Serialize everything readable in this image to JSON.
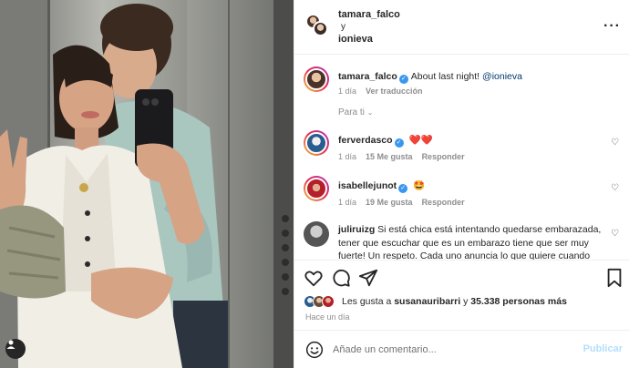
{
  "header": {
    "user1": "tamara_falco",
    "separator": "y",
    "user2": "ionieva",
    "more_icon": "more-horizontal-icon"
  },
  "caption": {
    "username": "tamara_falco",
    "text": "About last night!",
    "mention": "@ionieva",
    "time": "1 día",
    "translate": "Ver traducción"
  },
  "filter": {
    "label": "Para ti"
  },
  "comments": [
    {
      "username": "ferverdasco",
      "text": "❤️❤️",
      "time": "1 día",
      "likes": "15 Me gusta",
      "reply": "Responder"
    },
    {
      "username": "isabellejunot",
      "text": "🤩",
      "time": "1 día",
      "likes": "19 Me gusta",
      "reply": "Responder"
    },
    {
      "username": "juliruizg",
      "text": "Si está chica está intentando quedarse embarazada, tener que escuchar que es un embarazo tiene que ser muy fuerte! Un respeto. Cada uno anuncia lo que quiere cuando"
    }
  ],
  "likes": {
    "prefix": "Les gusta a",
    "user": "susanauribarri",
    "connector": "y",
    "count": "35.338 personas más"
  },
  "posted": "Hace un día",
  "composer": {
    "placeholder": "Añade un comentario...",
    "publish": "Publicar"
  },
  "colors": {
    "accent": "#0095f6",
    "verified": "#3897f0",
    "publish_disabled": "#b2dffc",
    "heart_red": "#ed4956"
  }
}
